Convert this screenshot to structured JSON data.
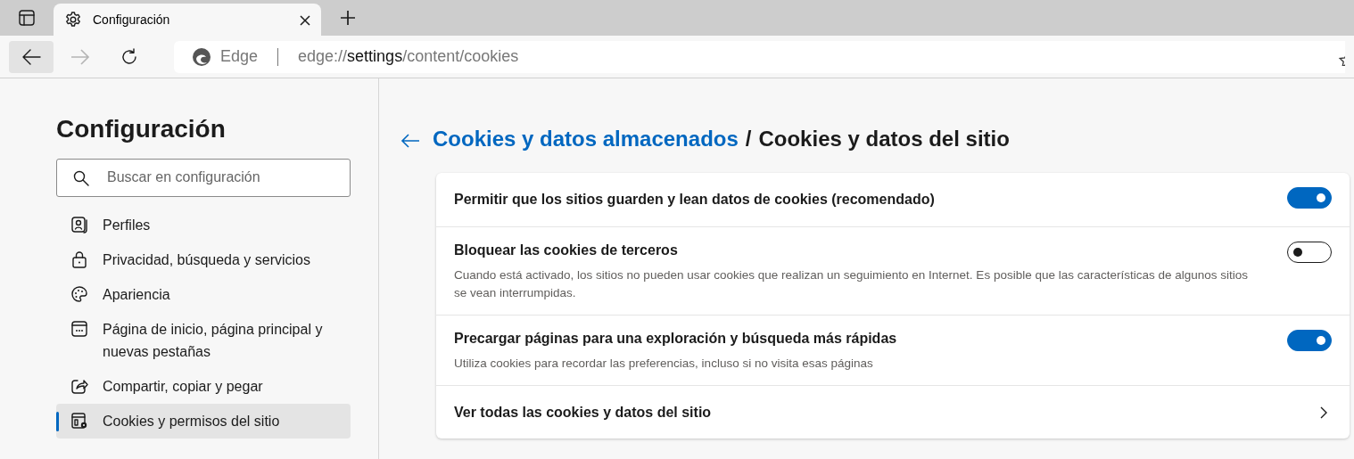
{
  "tabs": [
    {
      "label": "Configuración",
      "selected": true
    }
  ],
  "address": {
    "brand": "Edge",
    "scheme": "edge://",
    "host": "settings",
    "path": "/content/cookies"
  },
  "sidebar": {
    "title": "Configuración",
    "search": {
      "placeholder": "Buscar en configuración"
    },
    "items": [
      {
        "label": "Perfiles",
        "kind": "profile",
        "selected": false
      },
      {
        "label": "Privacidad, búsqueda y servicios",
        "kind": "lock",
        "selected": false
      },
      {
        "label": "Apariencia",
        "kind": "palette",
        "selected": false
      },
      {
        "label": "Página de inicio, página principal y nuevas pestañas",
        "kind": "home",
        "selected": false
      },
      {
        "label": "Compartir, copiar y pegar",
        "kind": "share",
        "selected": false
      },
      {
        "label": "Cookies y permisos del sitio",
        "kind": "cookies",
        "selected": true
      }
    ]
  },
  "header": {
    "parent": "Cookies y datos almacenados",
    "separator": "/",
    "current": "Cookies y datos del sitio"
  },
  "settings": [
    {
      "kind": "toggle",
      "label": "Permitir que los sitios guarden y lean datos de cookies (recomendado)",
      "on": true
    },
    {
      "kind": "toggle",
      "label": "Bloquear las cookies de terceros",
      "description": "Cuando está activado, los sitios no pueden usar cookies que realizan un seguimiento en Internet. Es posible que las características de algunos sitios se vean interrumpidas.",
      "on": false
    },
    {
      "kind": "toggle",
      "label": "Precargar páginas para una exploración y búsqueda más rápidas",
      "description": "Utiliza cookies para recordar las preferencias, incluso si no visita esas páginas",
      "on": true
    },
    {
      "kind": "link",
      "label": "Ver todas las cookies y datos del sitio"
    }
  ]
}
